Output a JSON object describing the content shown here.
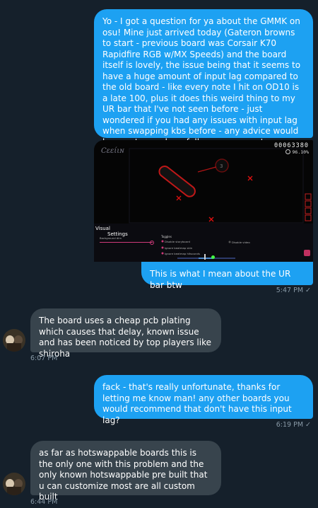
{
  "messages": [
    {
      "sender": "me",
      "text": "Yo - I got a question for ya about the GMMK on osu! Mine just arrived today (Gateron browns to start - previous board was Corsair K70 Rapidfire RGB w/MX Speeds) and the board itself is lovely, the issue being that it seems to have a huge amount of input lag compared to the old board - like every note I hit on OD10 is a late 100, plus it does this weird thing to my UR bar that I've not seen before - just wondered if you had any issues with input lag when swapping kbs before - any advice would be great man, hopefully see you on stream soon! -C"
    },
    {
      "sender": "me",
      "attachment": {
        "logo_text": "Cεείιɴ",
        "score": "00063380",
        "accuracy": "96.10%",
        "settings_title_line1": "Visual",
        "settings_title_line2": "Settings",
        "section_background": "Background dim",
        "section_toggles": "Toggles",
        "toggle_items": [
          "Disable storyboard",
          "Ignore beatmap skin",
          "Ignore beatmap hitsounds"
        ],
        "disable_video": "Disable video"
      },
      "text": "This is what I mean about the UR bar btw",
      "time": "5:47 PM"
    },
    {
      "sender": "them",
      "text": "The board uses a cheap pcb plating which causes that delay, known issue and has been noticed by top players like shiroha",
      "time": "6:07 PM"
    },
    {
      "sender": "me",
      "text": "fack - that's really unfortunate, thanks for letting me know man! any other boards you would recommend that don't have this input lag?",
      "time": "6:19 PM"
    },
    {
      "sender": "them",
      "text": "as far as hotswappable boards this is the only one with this problem and the only known hotswappable pre built that u can customize most are all custom built",
      "time": "6:44 PM"
    }
  ],
  "read_icon": "checkmark-icon",
  "colors": {
    "background": "#15202b",
    "outgoing_bubble": "#1da1f2",
    "incoming_bubble": "#38444d",
    "meta_text": "#8899a6"
  }
}
